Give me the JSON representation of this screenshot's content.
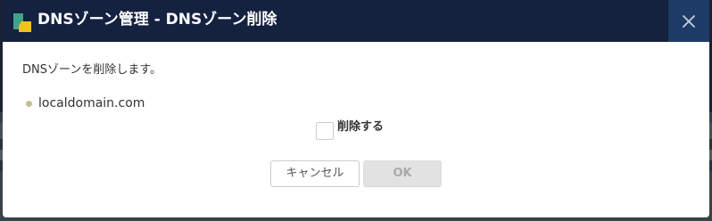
{
  "dialog": {
    "title": "DNSゾーン管理 - DNSゾーン削除",
    "close_icon": "close-icon",
    "logo_icon": "app-logo-icon"
  },
  "body": {
    "message": "DNSゾーンを削除します。",
    "zone_name": "localdomain.com",
    "confirm_checkbox": {
      "label": "削除する",
      "checked": false
    }
  },
  "buttons": {
    "cancel_label": "キャンセル",
    "ok_label": "OK",
    "ok_enabled": false
  },
  "colors": {
    "titlebar": "#14213f",
    "close_button": "#1e3a66",
    "logo_green": "#3fa58a",
    "logo_yellow": "#f2c21b",
    "bullet": "#c6bf95"
  }
}
